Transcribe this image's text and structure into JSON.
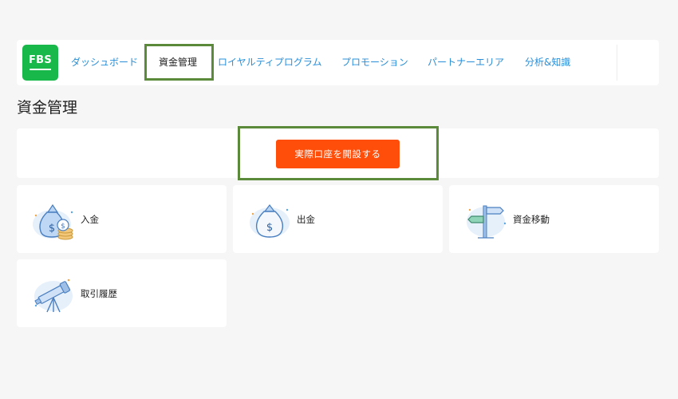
{
  "app": {
    "logo_text": "FBS"
  },
  "nav": {
    "items": [
      {
        "label": "ダッシュボード"
      },
      {
        "label": "資金管理"
      },
      {
        "label": "ロイヤルティプログラム"
      },
      {
        "label": "プロモーション"
      },
      {
        "label": "パートナーエリア"
      },
      {
        "label": "分析&知識"
      }
    ],
    "active_index": 1
  },
  "page": {
    "title": "資金管理"
  },
  "cta": {
    "label": "実際口座を開設する"
  },
  "cards": [
    {
      "label": "入金",
      "icon": "money-bag-coins-icon"
    },
    {
      "label": "出金",
      "icon": "money-bag-icon"
    },
    {
      "label": "資金移動",
      "icon": "signpost-icon"
    },
    {
      "label": "取引履歴",
      "icon": "telescope-icon"
    }
  ],
  "colors": {
    "brand_green": "#19b84a",
    "link_blue": "#2a8fd8",
    "cta_orange": "#ff4e0a",
    "highlight_green": "#5a8a3a",
    "background": "#f6f6f6"
  }
}
